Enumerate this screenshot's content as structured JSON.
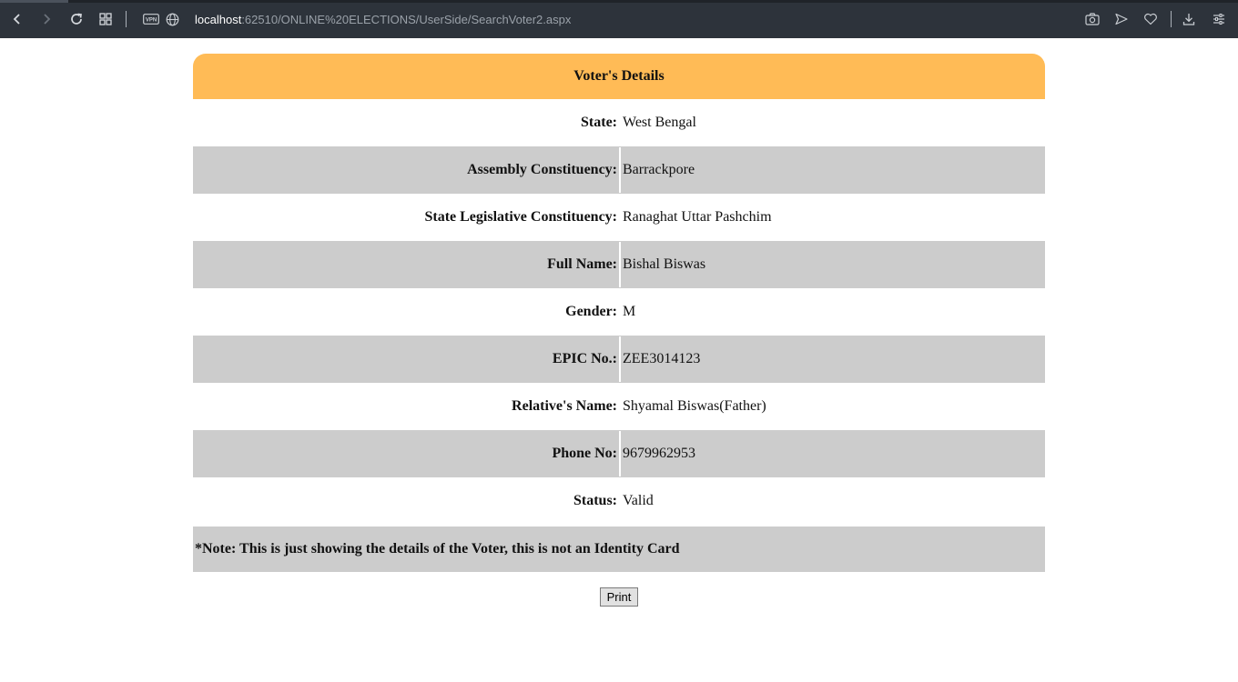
{
  "browser": {
    "url_host": "localhost",
    "url_path": ":62510/ONLINE%20ELECTIONS/UserSide/SearchVoter2.aspx",
    "vpn_badge": "VPN",
    "icons": [
      "back-icon",
      "forward-icon",
      "reload-icon",
      "speed-dial-icon",
      "vpn-icon",
      "globe-icon",
      "camera-icon",
      "send-icon",
      "heart-icon",
      "download-icon",
      "easy-setup-icon"
    ]
  },
  "voter": {
    "header": "Voter's Details",
    "rows": [
      {
        "label": "State:",
        "value": "West Bengal"
      },
      {
        "label": "Assembly Constituency:",
        "value": "Barrackpore"
      },
      {
        "label": "State Legislative Constituency:",
        "value": "Ranaghat Uttar Pashchim"
      },
      {
        "label": "Full Name:",
        "value": "Bishal Biswas"
      },
      {
        "label": "Gender:",
        "value": "M"
      },
      {
        "label": "EPIC No.:",
        "value": "ZEE3014123"
      },
      {
        "label": "Relative's Name:",
        "value": "Shyamal Biswas(Father)"
      },
      {
        "label": "Phone No:",
        "value": "9679962953"
      },
      {
        "label": "Status:",
        "value": "Valid"
      }
    ],
    "note": "*Note: This is just showing the details of the Voter, this is not an Identity Card",
    "print_label": "Print"
  },
  "colors": {
    "header_bg": "#ffbb56",
    "row_shade": "#cccccc",
    "chrome_bg": "#2d333b"
  }
}
